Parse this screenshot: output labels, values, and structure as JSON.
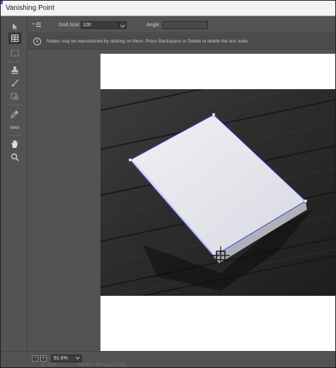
{
  "window": {
    "title": "Vanishing Point"
  },
  "options": {
    "grid_size_label": "Grid Size:",
    "grid_size_value": "100",
    "angle_label": "Angle:",
    "angle_value": ""
  },
  "info": {
    "message": "Nodes may be repositioned by clicking on them.  Press Backspace or Delete to delete the last node."
  },
  "tools": [
    {
      "name": "edit-plane-tool",
      "icon": "arrow-pointer-icon"
    },
    {
      "name": "create-plane-tool",
      "icon": "grid-plane-icon",
      "active": true
    },
    {
      "name": "marquee-tool",
      "icon": "dotted-rect-icon"
    },
    {
      "name": "stamp-tool",
      "icon": "stamp-icon"
    },
    {
      "name": "brush-tool",
      "icon": "brush-icon"
    },
    {
      "name": "transform-tool",
      "icon": "transform-icon"
    },
    {
      "name": "eyedropper-tool",
      "icon": "eyedropper-icon"
    },
    {
      "name": "measure-tool",
      "icon": "ruler-icon"
    },
    {
      "name": "hand-tool",
      "icon": "hand-icon"
    },
    {
      "name": "zoom-tool",
      "icon": "magnifier-icon"
    }
  ],
  "status": {
    "zoom_out_label": "−",
    "zoom_in_label": "+",
    "zoom_value": "61.6%",
    "behind_zoom": "67.02%",
    "behind_doc_info": "908 px x 960 px (72 ppi)"
  },
  "colors": {
    "panel": "#535353",
    "plane_outline": "#3f3fd0",
    "node": "#ffffff"
  }
}
